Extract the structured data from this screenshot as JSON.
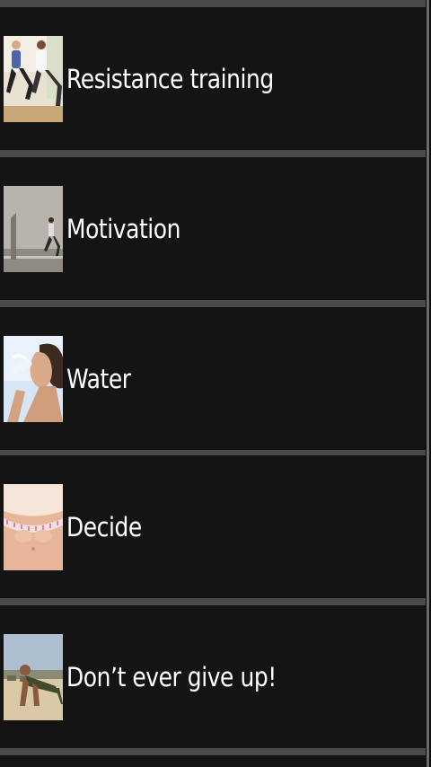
{
  "list": {
    "items": [
      {
        "label": "Resistance training",
        "icon": "lunge-couple-photo"
      },
      {
        "label": "Motivation",
        "icon": "runner-street-photo"
      },
      {
        "label": "Water",
        "icon": "drinking-water-photo"
      },
      {
        "label": "Decide",
        "icon": "measuring-tape-waist-photo"
      },
      {
        "label": "Don’t ever give up!",
        "icon": "pushup-soldiers-photo"
      }
    ]
  }
}
